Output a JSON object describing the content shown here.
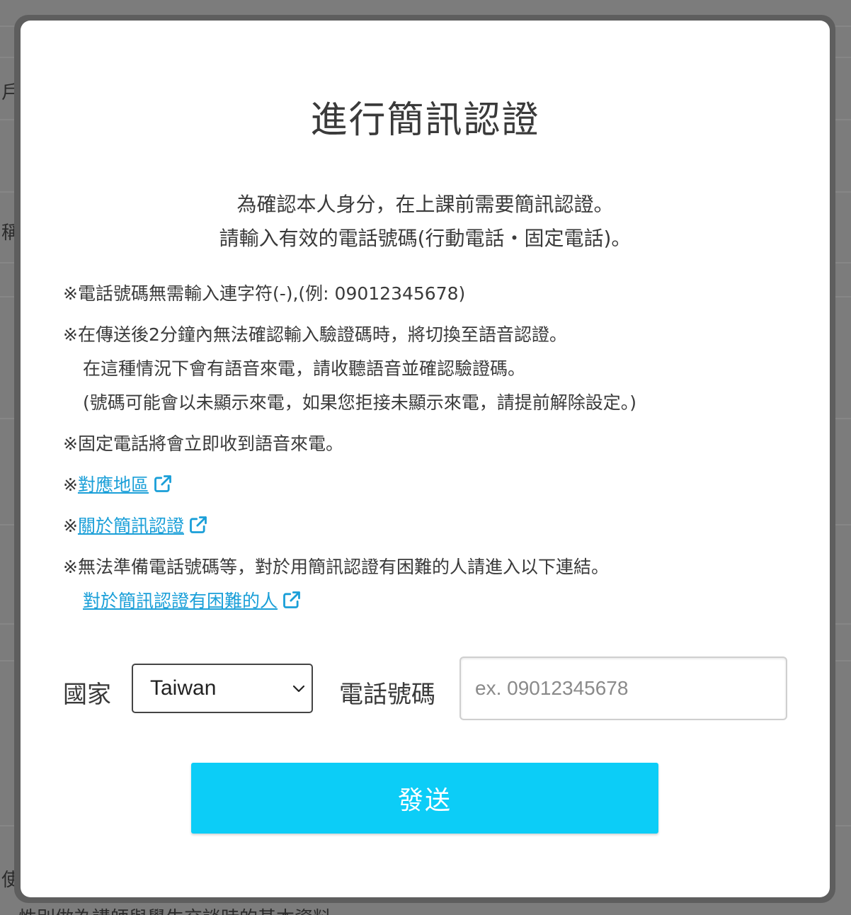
{
  "background": {
    "side_chars": [
      "戶",
      "稱",
      "使"
    ],
    "bottom_text": "性別做為講師與學生交談時的基本資料"
  },
  "modal": {
    "title": "進行簡訊認證",
    "intro_lines": [
      "為確認本人身分，在上課前需要簡訊認證。",
      "請輸入有效的電話號碼(行動電話・固定電話)。"
    ],
    "notes": {
      "hyphen": "※電話號碼無需輸入連字符(-),(例: 09012345678)",
      "voice_line1": "※在傳送後2分鐘內無法確認輸入驗證碼時，將切換至語音認證。",
      "voice_line2": "在這種情況下會有語音來電，請收聽語音並確認驗證碼。",
      "voice_line3": "(號碼可能會以未顯示來電，如果您拒接未顯示來電，請提前解除設定。)",
      "landline": "※固定電話將會立即收到語音來電。",
      "mark": "※",
      "region_link": "對應地區",
      "about_link": "關於簡訊認證",
      "difficulty_line": "※無法準備電話號碼等，對於用簡訊認證有困難的人請進入以下連結。",
      "difficulty_link": "對於簡訊認證有困難的人"
    },
    "form": {
      "country_label": "國家",
      "country_value": "Taiwan",
      "phone_label": "電話號碼",
      "phone_placeholder": "ex. 09012345678",
      "phone_value": ""
    },
    "send_label": "發送"
  },
  "colors": {
    "link": "#1a9fd8",
    "button": "#0ccdf7",
    "overlay": "#7a7a7a"
  },
  "icons": {
    "external_link": "external-link-icon",
    "select_chevron": "chevron-down-icon"
  }
}
